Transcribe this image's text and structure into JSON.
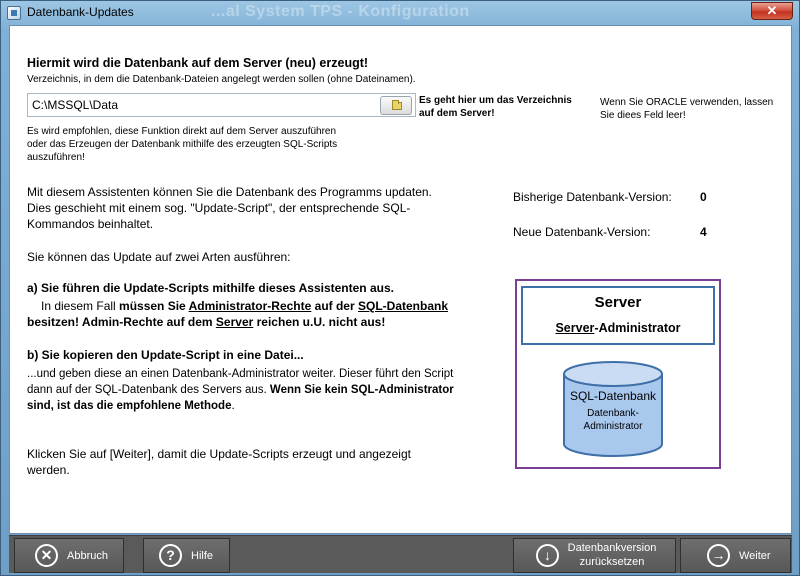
{
  "window": {
    "title": "Datenbank-Updates",
    "ghost_title": "...al System TPS  -  Konfiguration",
    "close_label": "✕"
  },
  "form": {
    "heading": "Hiermit wird die Datenbank auf dem Server (neu) erzeugt!",
    "dir_label": "Verzeichnis, in dem die Datenbank-Dateien angelegt werden sollen (ohne Dateinamen).",
    "path_value": "C:\\MSSQL\\Data",
    "path_note": "Es geht hier um das Verzeichnis auf dem Server!",
    "oracle_note": "Wenn Sie ORACLE verwenden, lassen Sie diees Feld leer!",
    "recommend": "Es wird empfohlen, diese Funktion direkt auf dem Server auszuführen oder das Erzeugen der Datenbank mithilfe des erzeugten SQL-Scripts auszuführen!"
  },
  "info": {
    "intro": "Mit diesem Assistenten können Sie die Datenbank des Programms updaten. Dies geschieht mit einem sog. \"Update-Script\", der entsprechende SQL-Kommandos beinhaltet.",
    "ways": "Sie können das Update auf zwei Arten ausführen:",
    "opt_a_title": "a) Sie führen die Update-Scripts mithilfe dieses Assistenten aus.",
    "opt_a": {
      "p1": "In diesem Fall ",
      "p2": "müssen Sie ",
      "p3": "Administrator-Rechte",
      "p4": " auf der ",
      "p5": "SQL-Datenbank",
      "p6": "besitzen! Admin-Rechte auf dem ",
      "p7": "Server",
      "p8": " reichen u.U. nicht aus!"
    },
    "opt_b_title": "b) Sie kopieren den Update-Script in eine Datei...",
    "opt_b": {
      "p1": "...und geben diese an einen Datenbank-Administrator weiter. Dieser führt den Script dann auf der SQL-Datenbank des Servers aus. ",
      "p2": "Wenn Sie kein SQL-Administrator sind, ist das die empfohlene Methode",
      "p3": "."
    },
    "footer": "Klicken Sie auf [Weiter], damit die Update-Scripts erzeugt und angezeigt werden."
  },
  "versions": {
    "old_label": "Bisherige Datenbank-Version:",
    "old_value": "0",
    "new_label": "Neue Datenbank-Version:",
    "new_value": "4"
  },
  "diagram": {
    "server_title": "Server",
    "server_admin_u": "Server",
    "server_admin_rest": "-Administrator",
    "db_title": "SQL-Datenbank",
    "db_sub1": "Datenbank-",
    "db_sub2": "Administrator"
  },
  "toolbar": {
    "cancel": "Abbruch",
    "help": "Hilfe",
    "reset_line1": "Datenbankversion",
    "reset_line2": "zurücksetzen",
    "next": "Weiter"
  },
  "colors": {
    "diagram_border": "#7b3f95",
    "server_border": "#3e6fa8",
    "db_fill": "#a9c8ee",
    "toolbar": "#5a5a5a"
  }
}
